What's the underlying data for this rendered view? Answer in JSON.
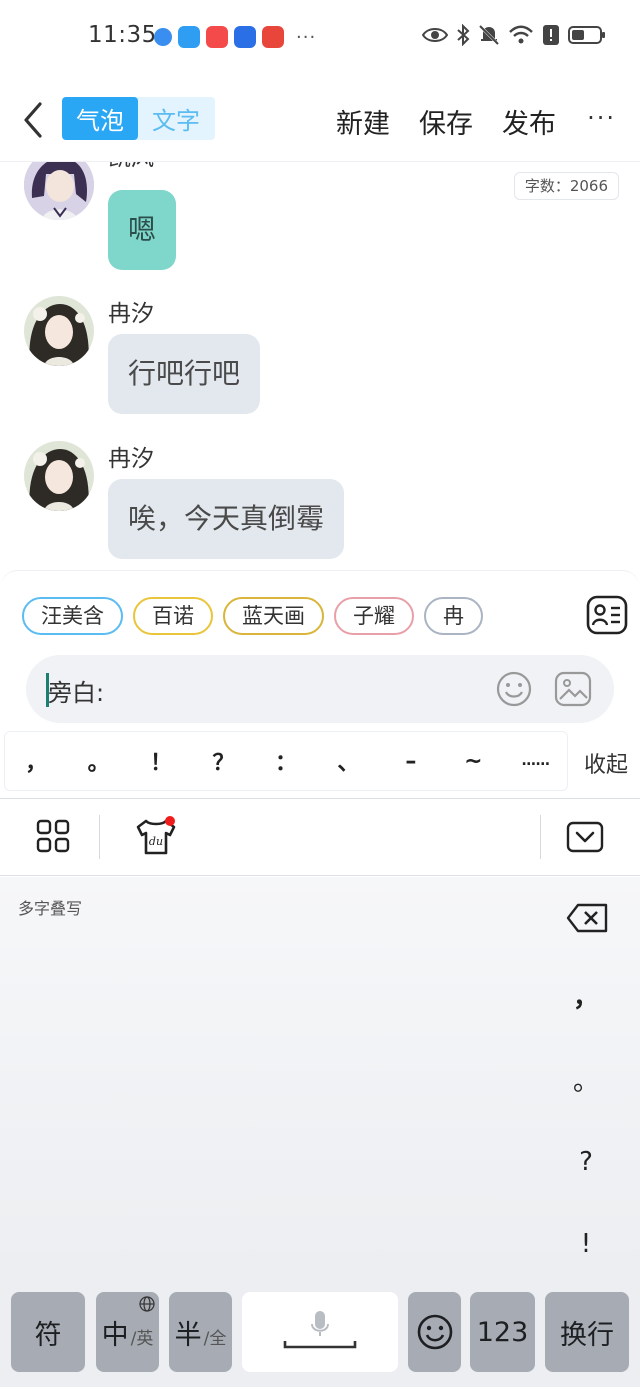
{
  "status_bar": {
    "time": "11:35",
    "more": "···"
  },
  "toolbar": {
    "mode_bubble": "气泡",
    "mode_text": "文字",
    "new_label": "新建",
    "save_label": "保存",
    "publish_label": "发布",
    "more_label": "···"
  },
  "chat": {
    "word_count": "字数：2066",
    "messages": [
      {
        "sender": "凯风",
        "text": "嗯"
      },
      {
        "sender": "冉汐",
        "text": "行吧行吧"
      },
      {
        "sender": "冉汐",
        "text": "唉，今天真倒霉"
      }
    ]
  },
  "input": {
    "roles": [
      "汪美含",
      "百诺",
      "蓝天画",
      "子耀",
      "冉"
    ],
    "role_colors": [
      "#5bbcf2",
      "#e9c53b",
      "#d9b53a",
      "#e8a0a8",
      "#aab4c2"
    ],
    "label": "旁白:",
    "punctuation": [
      "，",
      "。",
      "！",
      "？",
      "：",
      "、",
      "–",
      "~",
      "……"
    ],
    "collapse_label": "收起"
  },
  "keyboard": {
    "hw_hint": "多字叠写",
    "side_punct": [
      "，",
      "。",
      "?",
      "!"
    ],
    "key_symbol": "符",
    "key_cn": "中",
    "key_cn_sub": "/英",
    "key_half": "半",
    "key_half_sub": "/全",
    "key_123": "123",
    "key_enter": "换行"
  }
}
